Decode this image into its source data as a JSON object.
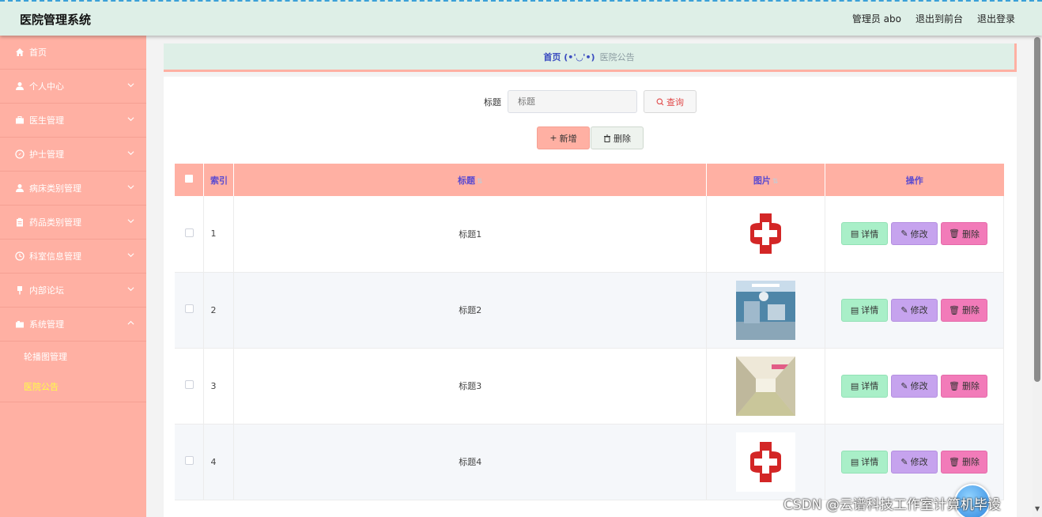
{
  "header": {
    "title": "医院管理系统",
    "role_user": "管理员 abo",
    "front_link": "退出到前台",
    "logout": "退出登录"
  },
  "sidebar": {
    "items": [
      {
        "label": "首页",
        "icon": "home-icon",
        "expandable": false
      },
      {
        "label": "个人中心",
        "icon": "user-icon",
        "expandable": true
      },
      {
        "label": "医生管理",
        "icon": "briefcase-icon",
        "expandable": true
      },
      {
        "label": "护士管理",
        "icon": "compass-icon",
        "expandable": true
      },
      {
        "label": "病床类别管理",
        "icon": "user-icon",
        "expandable": true
      },
      {
        "label": "药品类别管理",
        "icon": "clipboard-icon",
        "expandable": true
      },
      {
        "label": "科室信息管理",
        "icon": "clock-icon",
        "expandable": true
      },
      {
        "label": "内部论坛",
        "icon": "pin-icon",
        "expandable": true
      },
      {
        "label": "系统管理",
        "icon": "camera-icon",
        "expandable": true,
        "expanded": true
      }
    ],
    "sub_items": [
      {
        "label": "轮播图管理",
        "active": false
      },
      {
        "label": "医院公告",
        "active": true
      }
    ]
  },
  "breadcrumb": {
    "home": "首页",
    "face": "(•'◡'•)",
    "current": "医院公告"
  },
  "search": {
    "label": "标题",
    "placeholder": "标题",
    "query_button": "查询"
  },
  "actions": {
    "add": "新增",
    "delete": "删除"
  },
  "table": {
    "headers": {
      "index": "索引",
      "title": "标题",
      "image": "图片",
      "ops": "操作"
    },
    "rows": [
      {
        "index": "1",
        "title": "标题1",
        "image": "red-cross"
      },
      {
        "index": "2",
        "title": "标题2",
        "image": "operating-room"
      },
      {
        "index": "3",
        "title": "标题3",
        "image": "hospital-corridor"
      },
      {
        "index": "4",
        "title": "标题4",
        "image": "red-cross"
      }
    ],
    "op_labels": {
      "detail": "详情",
      "edit": "修改",
      "delete": "删除"
    }
  },
  "watermark": "CSDN @云谱科技工作室计算机毕设",
  "colors": {
    "sidebar": "#ffb0a3",
    "header_bg": "#deefe7",
    "detail_btn": "#a9efc8",
    "edit_btn": "#c6a3ee",
    "delete_btn": "#f27bb9",
    "active_sub": "#ffff44"
  }
}
